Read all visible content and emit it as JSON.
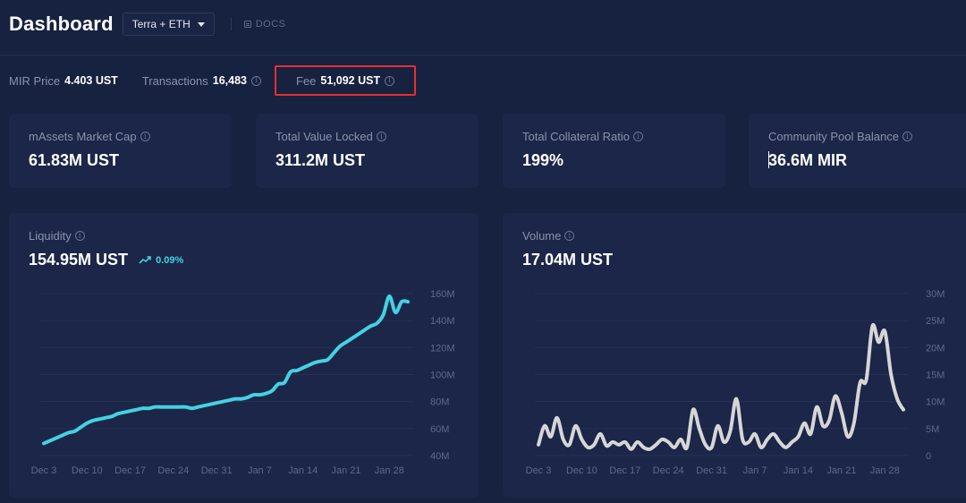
{
  "header": {
    "title": "Dashboard",
    "network": "Terra + ETH",
    "docs_label": "DOCS"
  },
  "stats": {
    "mir_price_label": "MIR Price",
    "mir_price_value": "4.403 UST",
    "transactions_label": "Transactions",
    "transactions_value": "16,483",
    "fee_label": "Fee",
    "fee_value": "51,092 UST"
  },
  "cards": {
    "market_cap_label": "mAssets Market Cap",
    "market_cap_value": "61.83M UST",
    "tvl_label": "Total Value Locked",
    "tvl_value": "311.2M UST",
    "collateral_label": "Total Collateral Ratio",
    "collateral_value": "199%",
    "community_label": "Community Pool Balance",
    "community_value": "36.6M MIR"
  },
  "colors": {
    "background": "#172240",
    "card": "#1b2648",
    "liquidity_line": "#45d1e1",
    "volume_line": "#d6d6d6",
    "highlight_box": "#e53030"
  },
  "liquidity": {
    "label": "Liquidity",
    "value": "154.95M UST",
    "change": "0.09%"
  },
  "volume": {
    "label": "Volume",
    "value": "17.04M UST"
  },
  "chart_data": [
    {
      "type": "line",
      "title": "Liquidity",
      "x_tick_labels": [
        "Dec 3",
        "Dec 10",
        "Dec 17",
        "Dec 24",
        "Dec 31",
        "Jan 7",
        "Jan 14",
        "Jan 21",
        "Jan 28"
      ],
      "y_tick_labels": [
        "40M",
        "60M",
        "80M",
        "100M",
        "120M",
        "140M",
        "160M"
      ],
      "ylim": [
        40,
        160
      ],
      "y_unit": "M",
      "x_days_range": [
        0,
        59
      ],
      "series": [
        {
          "color": "#45d1e1",
          "x": [
            0,
            1,
            2,
            3,
            4,
            5,
            6,
            7,
            8,
            9,
            10,
            11,
            12,
            13,
            14,
            15,
            16,
            17,
            18,
            19,
            20,
            21,
            22,
            23,
            24,
            25,
            26,
            27,
            28,
            29,
            30,
            31,
            32,
            33,
            34,
            35,
            36,
            37,
            38,
            39,
            40,
            41,
            42,
            43,
            44,
            45,
            46,
            47,
            48,
            49,
            50,
            51,
            52,
            53,
            54,
            55,
            56,
            57,
            58,
            59
          ],
          "values": [
            49,
            51,
            53,
            55,
            57,
            58,
            61,
            64,
            66,
            67,
            68,
            69,
            71,
            72,
            73,
            74,
            75,
            75,
            76,
            76,
            76,
            76,
            76,
            76,
            75,
            76,
            77,
            78,
            79,
            80,
            81,
            82,
            82,
            83,
            85,
            85,
            86,
            88,
            93,
            94,
            102,
            103,
            105,
            107,
            109,
            110,
            111,
            116,
            121,
            124,
            127,
            130,
            133,
            136,
            138,
            144,
            158,
            146,
            154,
            154
          ]
        }
      ]
    },
    {
      "type": "line",
      "title": "Volume",
      "x_tick_labels": [
        "Dec 3",
        "Dec 10",
        "Dec 17",
        "Dec 24",
        "Dec 31",
        "Jan 7",
        "Jan 14",
        "Jan 21",
        "Jan 28"
      ],
      "y_tick_labels": [
        "0",
        "5M",
        "10M",
        "15M",
        "20M",
        "25M",
        "30M"
      ],
      "ylim": [
        0,
        30
      ],
      "y_unit": "M",
      "x_days_range": [
        0,
        59
      ],
      "series": [
        {
          "color": "#d6d6d6",
          "x": [
            0,
            1,
            2,
            3,
            4,
            5,
            6,
            7,
            8,
            9,
            10,
            11,
            12,
            13,
            14,
            15,
            16,
            17,
            18,
            19,
            20,
            21,
            22,
            23,
            24,
            25,
            26,
            27,
            28,
            29,
            30,
            31,
            32,
            33,
            34,
            35,
            36,
            37,
            38,
            39,
            40,
            41,
            42,
            43,
            44,
            45,
            46,
            47,
            48,
            49,
            50,
            51,
            52,
            53,
            54,
            55,
            56,
            57,
            58,
            59
          ],
          "values": [
            2.0,
            5.5,
            3.5,
            7.0,
            3.0,
            2.0,
            5.5,
            3.0,
            1.5,
            2.0,
            4.0,
            1.8,
            2.5,
            2.0,
            2.5,
            1.2,
            2.5,
            1.5,
            1.2,
            2.0,
            3.0,
            2.5,
            1.5,
            3.0,
            1.5,
            8.5,
            5.0,
            2.0,
            1.5,
            5.5,
            2.5,
            4.5,
            10.5,
            3.0,
            2.5,
            4.0,
            1.5,
            3.0,
            4.0,
            2.5,
            1.5,
            2.5,
            3.5,
            6.0,
            4.0,
            9.0,
            5.5,
            6.5,
            11.0,
            8.0,
            3.5,
            6.0,
            13.5,
            14.0,
            24.0,
            21.0,
            23.0,
            15.0,
            10.5,
            8.5
          ]
        }
      ]
    }
  ]
}
